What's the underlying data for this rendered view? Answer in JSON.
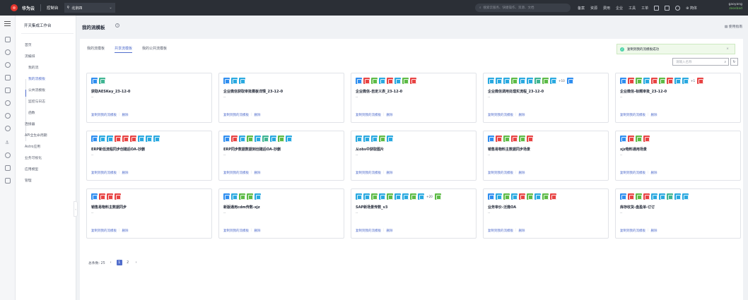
{
  "topbar": {
    "brand": "华为云",
    "console": "控制台",
    "region": "北京四",
    "search_placeholder": "搜索云服务、快捷操作、资源、文档",
    "links": [
      "备案",
      "资源",
      "费用",
      "企业",
      "工具",
      "工单"
    ],
    "lang": "简体",
    "user_name": "gaoyang",
    "user_status": "zoosbad"
  },
  "sidebar": {
    "title": "开天集成工作台",
    "items": [
      {
        "label": "首页"
      },
      {
        "label": "流编排"
      },
      {
        "label": "连接器"
      },
      {
        "label": "API全生命周期"
      },
      {
        "label": "Astro应用"
      },
      {
        "label": "业务可视化"
      },
      {
        "label": "应用模型"
      },
      {
        "label": "管理"
      }
    ],
    "subitems": [
      {
        "label": "我的流"
      },
      {
        "label": "我的流模板"
      },
      {
        "label": "公共流模板"
      },
      {
        "label": "监控与日志"
      },
      {
        "label": "函数"
      }
    ]
  },
  "main": {
    "title": "我的流模板",
    "guide": "使用指南",
    "tabs": [
      "我的流模板",
      "共享流模板",
      "我的公共流模板"
    ],
    "toast": "复制到我的流模板成功",
    "search_placeholder": "请输入名称",
    "action_copy": "复制到我的流模板",
    "action_delete": "删除",
    "desc_placeholder": "--",
    "pagination": {
      "total_label": "总条数: 25",
      "pages": [
        "1",
        "2"
      ],
      "current": "1"
    }
  },
  "cards": [
    {
      "title": "获取AESKey_23-12-0",
      "icons": [
        "#2f8ef0",
        "#3fb592"
      ],
      "more": ""
    },
    {
      "title": "企业微信获取审批模板详情_23-12-0",
      "icons": [
        "#2f8ef0",
        "#29a9e0",
        "#29a9e0"
      ],
      "more": ""
    },
    {
      "title": "企业微信-自定义表_23-12-0",
      "icons": [
        "#2f8ef0",
        "#e84343",
        "#5dbb46",
        "#29a9e0",
        "#e84343",
        "#29a9e0",
        "#5dbb46",
        "#e84343"
      ],
      "more": ""
    },
    {
      "title": "企业微信调用处理实流程_23-12-0",
      "icons": [
        "#29a9e0",
        "#29a9e0",
        "#29a9e0",
        "#5dbb46",
        "#29a9e0",
        "#29a9e0",
        "#3fb592",
        "#5dbb46",
        "#29a9e0",
        "#2f8ef0"
      ],
      "more": "+10"
    },
    {
      "title": "企业微信-标题审批_23-12-0",
      "icons": [
        "#2f8ef0",
        "#e84343",
        "#5dbb46",
        "#29a9e0",
        "#e84343",
        "#5dbb46",
        "#e84343",
        "#29a9e0",
        "#29a9e0",
        "#e84343"
      ],
      "more": "+1"
    },
    {
      "title": "ERP新低流程同步创建后OA-抄删",
      "icons": [
        "#2f8ef0",
        "#29a9e0",
        "#29a9e0",
        "#e84343",
        "#e84343",
        "#e84343",
        "#29a9e0",
        "#29a9e0",
        "#29a9e0"
      ],
      "more": ""
    },
    {
      "title": "ERP同步数据数据到创建后OA-抄删",
      "icons": [
        "#2f8ef0",
        "#e84343",
        "#29a9e0",
        "#5dbb46",
        "#29a9e0",
        "#3fb592",
        "#29a9e0",
        "#5dbb46",
        "#29a9e0"
      ],
      "more": ""
    },
    {
      "title": "从obs中获取图片",
      "icons": [
        "#29a9e0",
        "#29a9e0",
        "#29a9e0",
        "#5dbb46",
        "#29a9e0"
      ],
      "more": ""
    },
    {
      "title": "销售易物料主数据同步场景",
      "icons": [
        "#2f8ef0",
        "#e84343",
        "#5dbb46",
        "#e84343",
        "#5dbb46",
        "#e84343"
      ],
      "more": ""
    },
    {
      "title": "xjz物料通用场景",
      "icons": [
        "#2f8ef0",
        "#e84343",
        "#5dbb46",
        "#e84343"
      ],
      "more": ""
    },
    {
      "title": "销售易物料主数据同步",
      "icons": [
        "#2f8ef0",
        "#e84343",
        "#e84343",
        "#e84343"
      ],
      "more": ""
    },
    {
      "title": "新版通用cdm传数-xjz",
      "icons": [
        "#2f8ef0",
        "#29a9e0",
        "#5dbb46",
        "#5dbb46",
        "#29a9e0"
      ],
      "more": ""
    },
    {
      "title": "SAP新场景传数_v3",
      "icons": [
        "#29a9e0",
        "#29a9e0",
        "#5dbb46",
        "#29a9e0",
        "#5dbb46",
        "#29a9e0",
        "#29a9e0",
        "#5dbb46",
        "#29a9e0",
        "#5dbb46"
      ],
      "more": "+20"
    },
    {
      "title": "业务审价-泛微OA",
      "icons": [
        "#2f8ef0",
        "#29a9e0",
        "#5dbb46",
        "#29a9e0",
        "#e84343",
        "#5dbb46",
        "#29a9e0",
        "#5dbb46",
        "#e84343"
      ],
      "more": ""
    },
    {
      "title": "库存收货-盘盈单-订订",
      "icons": [
        "#2f8ef0",
        "#e84343",
        "#5dbb46",
        "#e84343",
        "#29a9e0",
        "#29a9e0",
        "#3fb592",
        "#29a9e0",
        "#29a9e0"
      ],
      "more": ""
    }
  ]
}
